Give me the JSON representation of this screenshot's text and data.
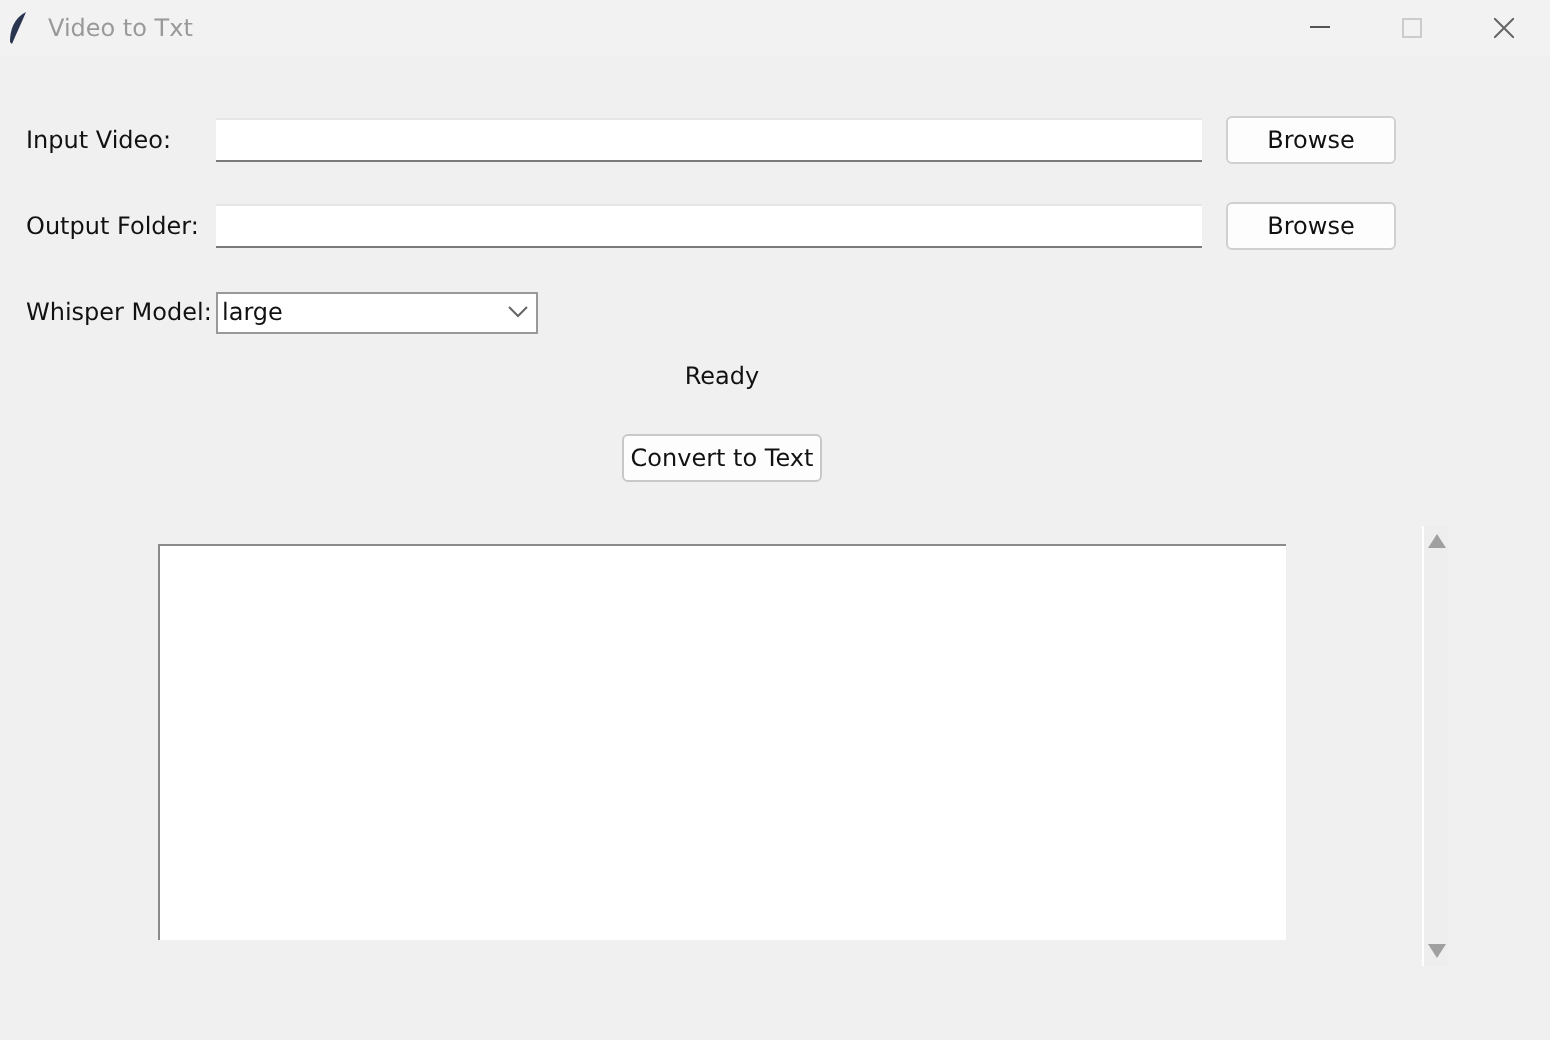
{
  "window": {
    "title": "Video to Txt"
  },
  "fields": [
    {
      "label": "Input Video:",
      "button": "Browse"
    },
    {
      "label": "Output Folder:",
      "button": "Browse"
    }
  ],
  "model": {
    "label": "Whisper Model:",
    "value": "large"
  },
  "status": "Ready",
  "convert_button": "Convert to Text"
}
